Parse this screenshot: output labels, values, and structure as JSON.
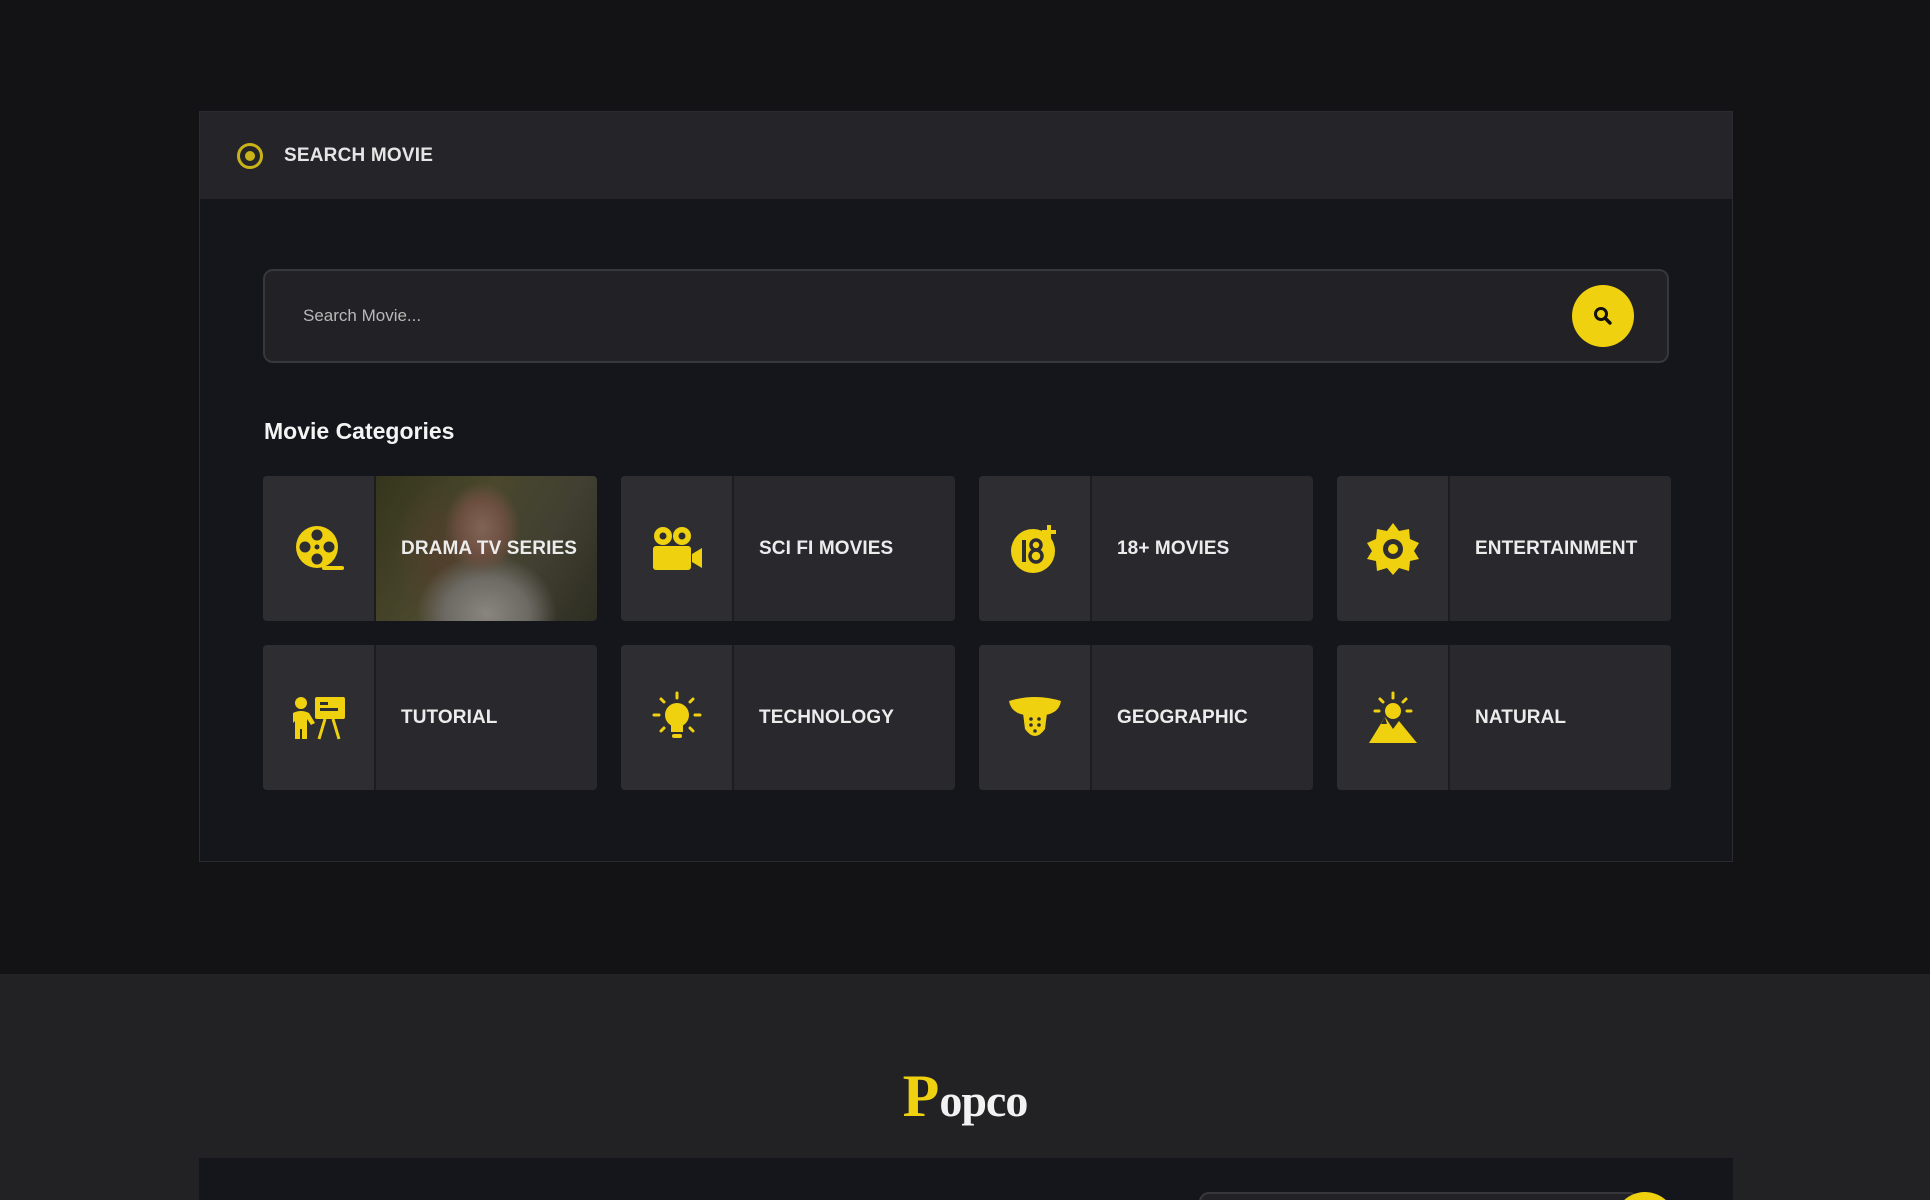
{
  "search_panel": {
    "header_title": "SEARCH MOVIE",
    "search_placeholder": "Search Movie...",
    "categories_heading": "Movie Categories"
  },
  "categories": [
    {
      "label": "DRAMA TV SERIES",
      "icon": "film-reel-icon"
    },
    {
      "label": "SCI FI MOVIES",
      "icon": "movie-camera-icon"
    },
    {
      "label": "18+ MOVIES",
      "icon": "age-18-plus-icon"
    },
    {
      "label": "ENTERTAINMENT",
      "icon": "gear-icon"
    },
    {
      "label": "TUTORIAL",
      "icon": "teacher-board-icon"
    },
    {
      "label": "TECHNOLOGY",
      "icon": "light-bulb-icon"
    },
    {
      "label": "GEOGRAPHIC",
      "icon": "mouth-tongue-icon"
    },
    {
      "label": "NATURAL",
      "icon": "sun-mountain-icon"
    }
  ],
  "footer": {
    "logo_first_letter": "P",
    "logo_rest": "opco"
  },
  "colors": {
    "accent": "#f0d10f",
    "panel_bg": "#15161b",
    "card_bg": "#29292d"
  }
}
